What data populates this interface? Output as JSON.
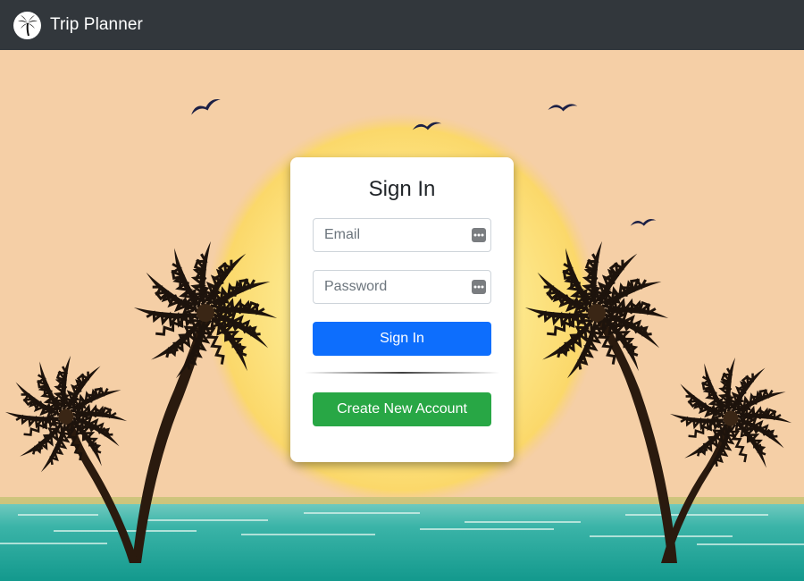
{
  "navbar": {
    "brand_title": "Trip Planner",
    "logo_icon": "palm-tree-icon",
    "background_color": "#32373c"
  },
  "scene": {
    "sky_color": "#f5cfa6",
    "sun_color": "#fde98f",
    "sea_color": "#1f9c92"
  },
  "signin": {
    "title": "Sign In",
    "email": {
      "placeholder": "Email",
      "value": "",
      "icon": "password-manager-key-icon"
    },
    "password": {
      "placeholder": "Password",
      "value": "",
      "icon": "password-manager-key-icon"
    },
    "signin_button_label": "Sign In",
    "create_account_label": "Create New Account",
    "signin_button_color": "#0d6efd",
    "create_account_color": "#28a745"
  }
}
